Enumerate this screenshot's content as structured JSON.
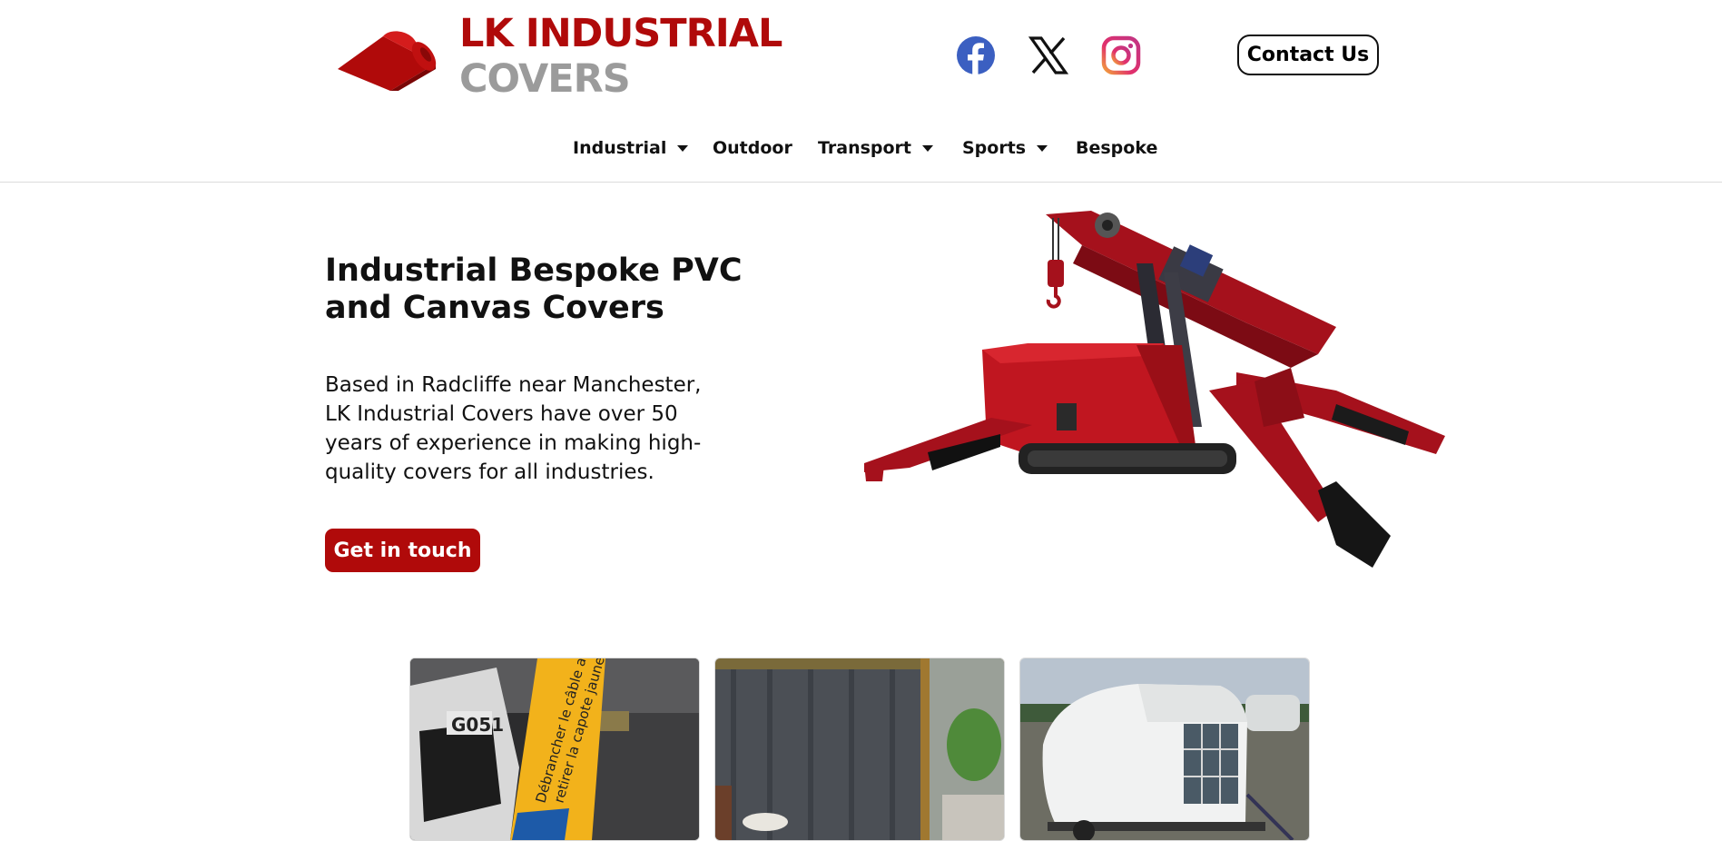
{
  "brand": {
    "line1": "LK INDUSTRIAL",
    "line2": "COVERS",
    "primary_color": "#b00a0a",
    "secondary_color": "#9b9b9b"
  },
  "social": {
    "facebook_icon": "facebook-icon",
    "x_icon": "x-twitter-icon",
    "instagram_icon": "instagram-icon"
  },
  "header": {
    "contact_label": "Contact Us"
  },
  "nav": {
    "items": [
      {
        "label": "Industrial",
        "dropdown": true
      },
      {
        "label": "Outdoor",
        "dropdown": false
      },
      {
        "label": "Transport",
        "dropdown": true
      },
      {
        "label": "Sports",
        "dropdown": true
      },
      {
        "label": "Bespoke",
        "dropdown": false
      }
    ]
  },
  "hero": {
    "title": "Industrial Bespoke PVC and Canvas Covers",
    "text": "Based in Radcliffe near Manchester, LK Industrial Covers have over 50 years of experience in making high-quality covers for all industries.",
    "cta_label": "Get in touch"
  },
  "cards": {
    "c1_tag": "G051",
    "c1_banner_line1": "Débrancher le câble avant",
    "c1_banner_line2": "retirer la capote jaune"
  }
}
